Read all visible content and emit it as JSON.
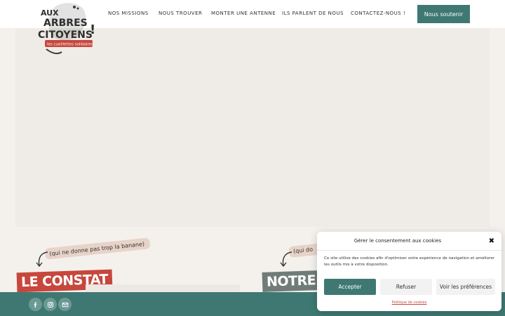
{
  "header": {
    "logo": {
      "lines": [
        "AUX",
        "ARBRES",
        "CITOYENS",
        "!"
      ],
      "tagline": "les cueillettes solidaires"
    },
    "nav": [
      {
        "label": "NOS MISSIONS"
      },
      {
        "label": "NOUS TROUVER"
      },
      {
        "label": "MONTER UNE ANTENNE"
      },
      {
        "label": "ILS PARLENT DE NOUS"
      },
      {
        "label": "CONTACTEZ-NOUS !"
      }
    ],
    "cta_label": "Nous soutenir"
  },
  "sections": {
    "left": {
      "tag": "(qui ne donne pas trop la banane)",
      "title": "LE CONSTAT"
    },
    "right": {
      "tag": "(qui do",
      "title": "NOTRE M"
    }
  },
  "social": [
    {
      "icon": "facebook-icon"
    },
    {
      "icon": "instagram-icon"
    },
    {
      "icon": "mail-icon"
    }
  ],
  "cookie": {
    "title": "Gérer le consentement aux cookies",
    "text": "Ce site utilise des cookies afin d'optimiser votre expérience de navigation et améliorer les outils mis à votre disposition.",
    "accept": "Accepter",
    "refuse": "Refuser",
    "prefs": "Voir les préférences",
    "policy": "Politique de cookies",
    "close_glyph": "✖"
  },
  "colors": {
    "brand_green": "#3f7873",
    "brand_red": "#c7473d",
    "background": "#f4f1ed"
  }
}
